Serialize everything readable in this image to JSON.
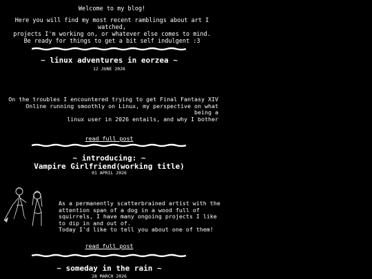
{
  "intro": {
    "welcome": "Welcome to my blog!",
    "description": "Here you will find my most recent ramblings about art I watched,\nprojects I'm working on, or whatever else comes to mind.\nBe ready for things to get a bit self indulgent :3"
  },
  "posts": [
    {
      "title": "~ linux adventures in eorzea ~",
      "date": "12 JUNE 2026",
      "excerpt": "On the troubles I encountered trying to get Final Fantasy XIV\nOnline running smoothly on Linux, my perspective on what being a\nlinux user in 2026 entails, and why I bother",
      "read_more": "read full post"
    },
    {
      "title": "~ introducing: ~\nVampire Girlfriend(working title)",
      "date": "01 APRIL 2026",
      "excerpt": "As a permanently scatterbrained artist with the\nattention span of a dog in a wood full of\nsquirrels, I have many ongoing projects I like\nto dip in and out of.\nToday I'd like to tell you about one of them!",
      "read_more": "read full post"
    },
    {
      "title": "~ someday in the rain ~",
      "date": "28 MARCH 2026"
    }
  ]
}
